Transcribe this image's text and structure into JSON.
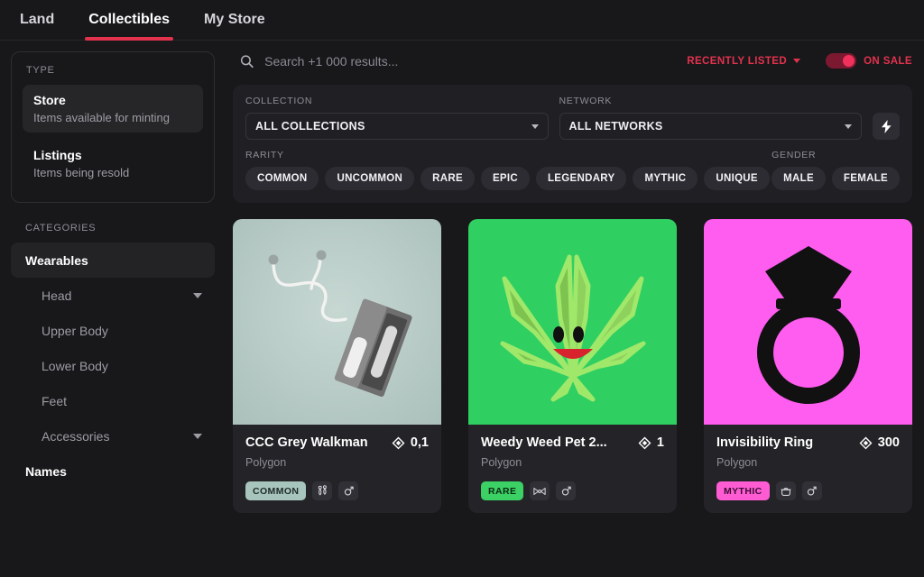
{
  "nav": {
    "tabs": [
      {
        "label": "Land",
        "active": false
      },
      {
        "label": "Collectibles",
        "active": true
      },
      {
        "label": "My Store",
        "active": false
      }
    ],
    "accent_color": "#e2324d"
  },
  "sidebar": {
    "type_label": "TYPE",
    "type_options": [
      {
        "title": "Store",
        "subtitle": "Items available for minting",
        "selected": true
      },
      {
        "title": "Listings",
        "subtitle": "Items being resold",
        "selected": false
      }
    ],
    "categories_label": "CATEGORIES",
    "categories": [
      {
        "label": "Wearables",
        "active": true,
        "sub": false,
        "chevron": false
      },
      {
        "label": "Head",
        "active": false,
        "sub": true,
        "chevron": true
      },
      {
        "label": "Upper Body",
        "active": false,
        "sub": true,
        "chevron": false
      },
      {
        "label": "Lower Body",
        "active": false,
        "sub": true,
        "chevron": false
      },
      {
        "label": "Feet",
        "active": false,
        "sub": true,
        "chevron": false
      },
      {
        "label": "Accessories",
        "active": false,
        "sub": true,
        "chevron": true
      },
      {
        "label": "Names",
        "active": false,
        "sub": false,
        "chevron": false
      }
    ]
  },
  "search": {
    "placeholder": "Search +1 000 results...",
    "value": "",
    "icon": "search-icon",
    "sort_label": "RECENTLY LISTED",
    "on_sale_label": "ON SALE",
    "on_sale_enabled": true
  },
  "filters": {
    "collection_label": "COLLECTION",
    "collection_value": "ALL COLLECTIONS",
    "network_label": "NETWORK",
    "network_value": "ALL NETWORKS",
    "bolt_icon": "lightning-bolt-icon",
    "rarity_label": "RARITY",
    "rarities": [
      "COMMON",
      "UNCOMMON",
      "RARE",
      "EPIC",
      "LEGENDARY",
      "MYTHIC",
      "UNIQUE"
    ],
    "gender_label": "GENDER",
    "genders": [
      "MALE",
      "FEMALE"
    ]
  },
  "cards": [
    {
      "title": "CCC Grey Walkman",
      "price": "0,1",
      "network": "Polygon",
      "rarity": "COMMON",
      "rarity_bg": "#a8c5bd",
      "rarity_fg": "#1f2b28",
      "bg_color": "#b9ccc7",
      "category_icon": "earrings-icon",
      "gender_icon": "gender-icon"
    },
    {
      "title": "Weedy Weed Pet 2...",
      "price": "1",
      "network": "Polygon",
      "rarity": "RARE",
      "rarity_bg": "#3bd165",
      "rarity_fg": "#0c2b14",
      "bg_color": "#30cf62",
      "category_icon": "bowtie-icon",
      "gender_icon": "gender-icon"
    },
    {
      "title": "Invisibility Ring",
      "price": "300",
      "network": "Polygon",
      "rarity": "MYTHIC",
      "rarity_bg": "#ff5cd4",
      "rarity_fg": "#3d0b32",
      "bg_color": "#ff5cf0",
      "category_icon": "ring-top-icon",
      "gender_icon": "gender-icon"
    }
  ]
}
